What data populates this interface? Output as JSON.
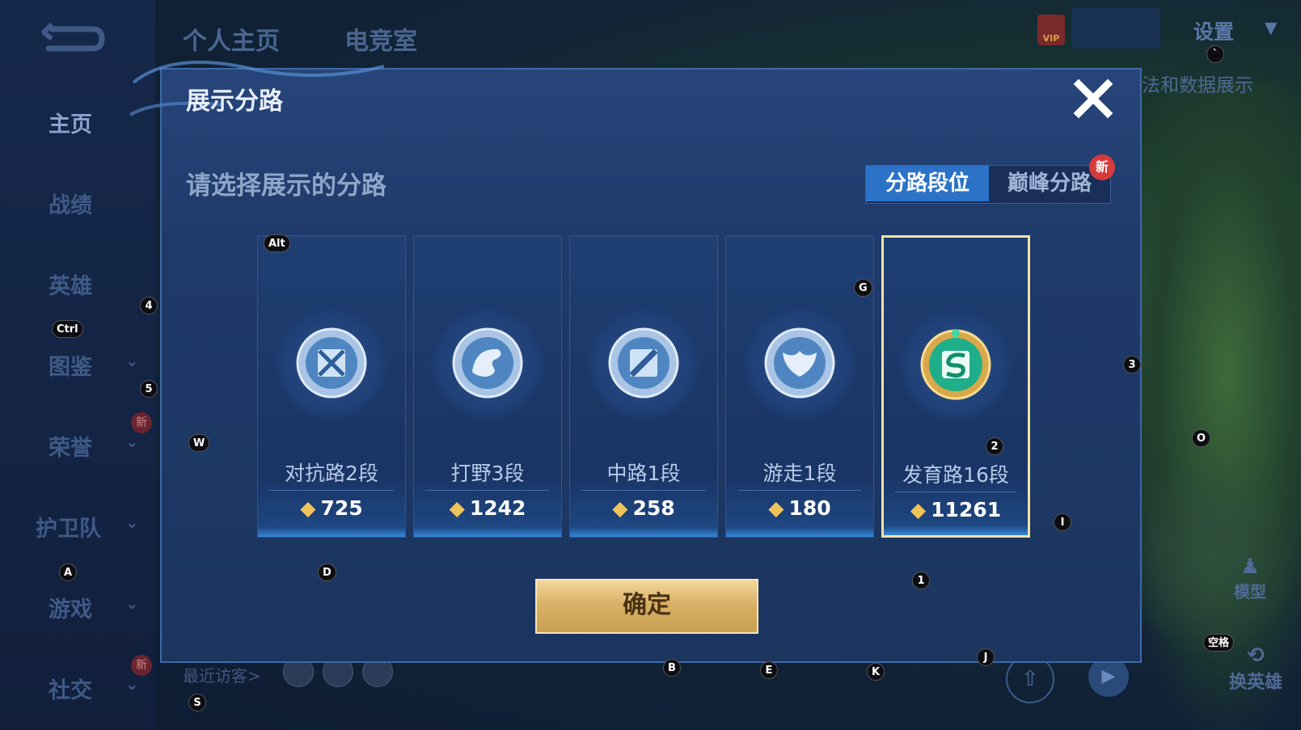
{
  "sidebar": {
    "back_icon": "back-arrow-icon",
    "items": [
      {
        "label": "主页",
        "active": true,
        "chevron": false,
        "new": false
      },
      {
        "label": "战绩",
        "active": false,
        "chevron": false,
        "new": false
      },
      {
        "label": "英雄",
        "active": false,
        "chevron": false,
        "new": false
      },
      {
        "label": "图鉴",
        "active": false,
        "chevron": true,
        "new": false
      },
      {
        "label": "荣誉",
        "active": false,
        "chevron": true,
        "new": true
      },
      {
        "label": "护卫队",
        "active": false,
        "chevron": true,
        "new": false
      },
      {
        "label": "游戏",
        "active": false,
        "chevron": true,
        "new": false
      },
      {
        "label": "社交",
        "active": false,
        "chevron": true,
        "new": true
      }
    ],
    "new_badge": "新"
  },
  "topbar": {
    "tabs": [
      "个人主页",
      "电竞室"
    ],
    "settings_label": "设置",
    "vip_label": "VIP",
    "data_label": "法和数据展示"
  },
  "background": {
    "model_label": "模型",
    "switch_hero_label": "换英雄",
    "visitors_label": "最近访客>"
  },
  "dialog": {
    "title": "展示分路",
    "prompt": "请选择展示的分路",
    "tabs": {
      "lane_rank": "分路段位",
      "peak_lane": "巅峰分路",
      "new_badge": "新"
    },
    "cards": [
      {
        "name": "对抗路2段",
        "score": "725",
        "icon": "clash-lane-icon",
        "selected": false
      },
      {
        "name": "打野3段",
        "score": "1242",
        "icon": "jungle-dragon-icon",
        "selected": false
      },
      {
        "name": "中路1段",
        "score": "258",
        "icon": "mid-lane-icon",
        "selected": false
      },
      {
        "name": "游走1段",
        "score": "180",
        "icon": "roam-wings-icon",
        "selected": false
      },
      {
        "name": "发育路16段",
        "score": "11261",
        "icon": "farm-lane-icon",
        "selected": true
      }
    ],
    "confirm_label": "确定",
    "close_icon": "close-x-icon"
  },
  "hotkeys": {
    "alt": "Alt",
    "ctrl": "Ctrl",
    "space": "空格",
    "k4": "4",
    "k5": "5",
    "k3": "3",
    "k2": "2",
    "k1": "1",
    "W": "W",
    "A": "A",
    "S": "S",
    "D": "D",
    "G": "G",
    "O": "O",
    "I": "I",
    "B": "B",
    "E": "E",
    "K": "K",
    "J": "J",
    "backtick": "`"
  },
  "colors": {
    "accent_blue": "#2c73c8",
    "selected_border": "#f3e1a9",
    "confirm_gold": "#d8b167",
    "new_red": "#d63b3b"
  }
}
